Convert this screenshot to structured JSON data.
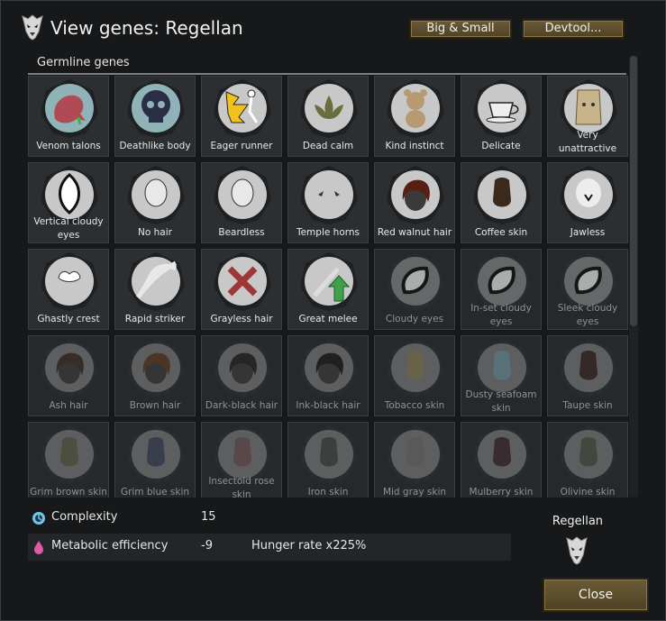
{
  "header": {
    "title": "View genes: Regellan",
    "big_small_label": "Big & Small",
    "devtool_label": "Devtool..."
  },
  "section": {
    "title": "Germline genes"
  },
  "genes": [
    {
      "label": "Venom talons",
      "icon": "venom-talons-icon",
      "active": true,
      "bg": "#8fb3b6"
    },
    {
      "label": "Deathlike body",
      "icon": "skull-icon",
      "active": true,
      "bg": "#8fb3b6"
    },
    {
      "label": "Eager runner",
      "icon": "runner-icon",
      "active": true,
      "bg": "#c8c8c8"
    },
    {
      "label": "Dead calm",
      "icon": "lotus-icon",
      "active": true,
      "bg": "#c8c8c8"
    },
    {
      "label": "Kind instinct",
      "icon": "teddy-bear-icon",
      "active": true,
      "bg": "#c8c8c8"
    },
    {
      "label": "Delicate",
      "icon": "teacup-icon",
      "active": true,
      "bg": "#c8c8c8"
    },
    {
      "label": "Very unattractive",
      "icon": "paper-bag-icon",
      "active": true,
      "bg": "#c8c8c8"
    },
    {
      "label": "Vertical cloudy eyes",
      "icon": "vertical-eye-icon",
      "active": true,
      "bg": "#c8c8c8"
    },
    {
      "label": "No hair",
      "icon": "bald-head-icon",
      "active": true,
      "bg": "#c8c8c8"
    },
    {
      "label": "Beardless",
      "icon": "beardless-face-icon",
      "active": true,
      "bg": "#c8c8c8"
    },
    {
      "label": "Temple horns",
      "icon": "horns-icon",
      "active": true,
      "bg": "#c8c8c8"
    },
    {
      "label": "Red walnut hair",
      "icon": "hair-icon",
      "active": true,
      "bg": "#c8c8c8",
      "swatch": "#5a1f14"
    },
    {
      "label": "Coffee skin",
      "icon": "skin-icon",
      "active": true,
      "bg": "#c8c8c8",
      "swatch": "#3b2a1c"
    },
    {
      "label": "Jawless",
      "icon": "jawless-icon",
      "active": true,
      "bg": "#c8c8c8"
    },
    {
      "label": "Ghastly crest",
      "icon": "crest-icon",
      "active": true,
      "bg": "#c8c8c8"
    },
    {
      "label": "Rapid striker",
      "icon": "claw-strike-icon",
      "active": true,
      "bg": "#c8c8c8"
    },
    {
      "label": "Grayless hair",
      "icon": "no-gray-hair-icon",
      "active": true,
      "bg": "#c8c8c8"
    },
    {
      "label": "Great melee",
      "icon": "sword-up-icon",
      "active": true,
      "bg": "#c8c8c8"
    },
    {
      "label": "Cloudy eyes",
      "icon": "cloudy-eye-icon",
      "active": false,
      "bg": "#7a7c7e"
    },
    {
      "label": "In-set cloudy eyes",
      "icon": "inset-eye-icon",
      "active": false,
      "bg": "#7a7c7e"
    },
    {
      "label": "Sleek cloudy eyes",
      "icon": "sleek-eye-icon",
      "active": false,
      "bg": "#7a7c7e"
    },
    {
      "label": "Ash hair",
      "icon": "hair-icon",
      "active": false,
      "bg": "#6e7072",
      "swatch": "#3e2d26"
    },
    {
      "label": "Brown hair",
      "icon": "hair-icon",
      "active": false,
      "bg": "#6e7072",
      "swatch": "#5a3a24"
    },
    {
      "label": "Dark-black hair",
      "icon": "hair-icon",
      "active": false,
      "bg": "#6e7072",
      "swatch": "#262626"
    },
    {
      "label": "Ink-black hair",
      "icon": "hair-icon",
      "active": false,
      "bg": "#6e7072",
      "swatch": "#1e1e1e"
    },
    {
      "label": "Tobacco skin",
      "icon": "skin-icon",
      "active": false,
      "bg": "#6e7072",
      "swatch": "#7d7552"
    },
    {
      "label": "Dusty seafoam skin",
      "icon": "skin-icon",
      "active": false,
      "bg": "#6e7072",
      "swatch": "#6b8a93"
    },
    {
      "label": "Taupe skin",
      "icon": "skin-icon",
      "active": false,
      "bg": "#6e7072",
      "swatch": "#3a2a26"
    },
    {
      "label": "Grim brown skin",
      "icon": "skin-icon",
      "active": false,
      "bg": "#6e7072",
      "swatch": "#5a5a48"
    },
    {
      "label": "Grim blue skin",
      "icon": "skin-icon",
      "active": false,
      "bg": "#6e7072",
      "swatch": "#3f4656"
    },
    {
      "label": "Insectoid rose skin",
      "icon": "skin-icon",
      "active": false,
      "bg": "#6e7072",
      "swatch": "#6a5355"
    },
    {
      "label": "Iron skin",
      "icon": "skin-icon",
      "active": false,
      "bg": "#6e7072",
      "swatch": "#454545"
    },
    {
      "label": "Mid gray skin",
      "icon": "skin-icon",
      "active": false,
      "bg": "#6e7072",
      "swatch": "#6a6a6a"
    },
    {
      "label": "Mulberry skin",
      "icon": "skin-icon",
      "active": false,
      "bg": "#6e7072",
      "swatch": "#3f2e31"
    },
    {
      "label": "Olivine skin",
      "icon": "skin-icon",
      "active": false,
      "bg": "#6e7072",
      "swatch": "#4b5446"
    }
  ],
  "stats": {
    "complexity": {
      "label": "Complexity",
      "value": "15",
      "icon": "complexity-icon",
      "color": "#6fc7e8"
    },
    "metabolic": {
      "label": "Metabolic efficiency",
      "value": "-9",
      "extra": "Hunger rate x225%",
      "icon": "metabolism-drop-icon",
      "color": "#e05aa8"
    }
  },
  "xenotype": {
    "name": "Regellan",
    "icon": "xenotype-icon"
  },
  "footer": {
    "close_label": "Close"
  }
}
